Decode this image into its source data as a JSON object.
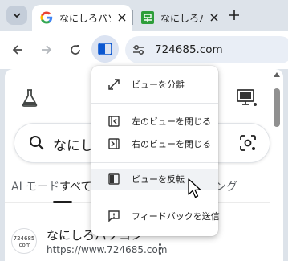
{
  "tabs": [
    {
      "title": "なにしろパソコン",
      "favicon": "google-g"
    },
    {
      "title": "なにしろパソコン",
      "favicon": "site-green"
    }
  ],
  "toolbar": {
    "url": "724685.com"
  },
  "page": {
    "search_text": "なにしろパソコン",
    "tabs": {
      "ai_mode": "AI モード",
      "all": "すべて",
      "shopping": "ング"
    },
    "result": {
      "logo_line1": "724685",
      "logo_line2": ".com",
      "title": "なにしろパソコン",
      "url": "https://www.724685.com"
    }
  },
  "menu": {
    "split": "ビューを分離",
    "close_left": "左のビューを閉じる",
    "close_right": "右のビューを閉じる",
    "reverse": "ビューを反転",
    "feedback": "フィードバックを送信"
  },
  "colors": {
    "tabstrip_bg": "#dde3ea",
    "split_button_bg": "#dbe3f2",
    "omnibox_bg": "#e9eef6",
    "accent_blue": "#0b57d0"
  }
}
